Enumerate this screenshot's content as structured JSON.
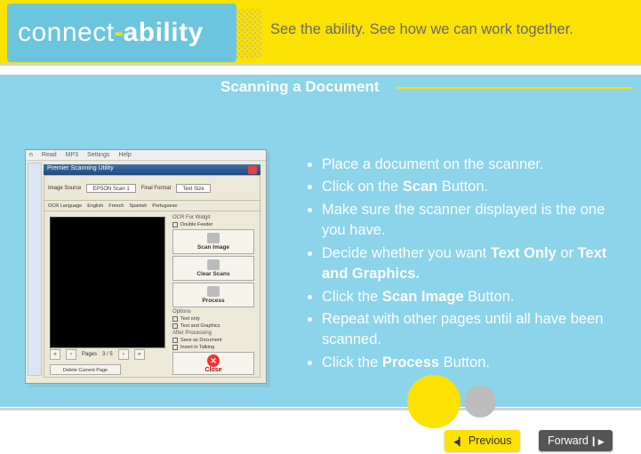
{
  "header": {
    "brand_left": "connect",
    "brand_dash": "-",
    "brand_right": "ability",
    "tagline": "See the ability. See how we can work together."
  },
  "page": {
    "title": "Scanning a Document"
  },
  "screenshot": {
    "menu": [
      "n",
      "Read",
      "MP3",
      "Settings",
      "Help"
    ],
    "titlebar": "Premier Scanning Utility",
    "dropdown_label": "Image Source",
    "dropdown_value": "EPSON Scan 1",
    "lang_label": "OCR Language",
    "langs": [
      "English",
      "French",
      "Spanish",
      "Portuguese"
    ],
    "right_label_ocr": "OCR For Widgit",
    "right_label_fmt": "Final Format",
    "check_bottom": "Double Feeder",
    "btn_scan": "Scan Image",
    "btn_clear": "Clear Scans",
    "btn_process": "Process",
    "opts": [
      "Text only",
      "Text and Graphics"
    ],
    "after_label": "After Processing",
    "after_opts": [
      "Save as Document",
      "Insert in Talking"
    ],
    "btn_close": "Close",
    "pages_label": "Pages",
    "pages_val": "3 / 5",
    "delete": "Delete Current Page"
  },
  "instructions": [
    {
      "text": "Place a document on the scanner."
    },
    {
      "pre": "Click on the ",
      "b": "Scan",
      "post": " Button."
    },
    {
      "text": "Make sure the scanner displayed is the one you have."
    },
    {
      "pre": "Decide whether you want ",
      "b": "Text Only",
      "mid": " or ",
      "b2": "Text and Graphics."
    },
    {
      "pre": "Click the ",
      "b": "Scan Image",
      "post": " Button."
    },
    {
      "text": "Repeat with other pages until all have been scanned."
    },
    {
      "pre": "Click the ",
      "b": "Process",
      "post": " Button."
    }
  ],
  "nav": {
    "prev": "Previous",
    "fwd": "Forward"
  }
}
